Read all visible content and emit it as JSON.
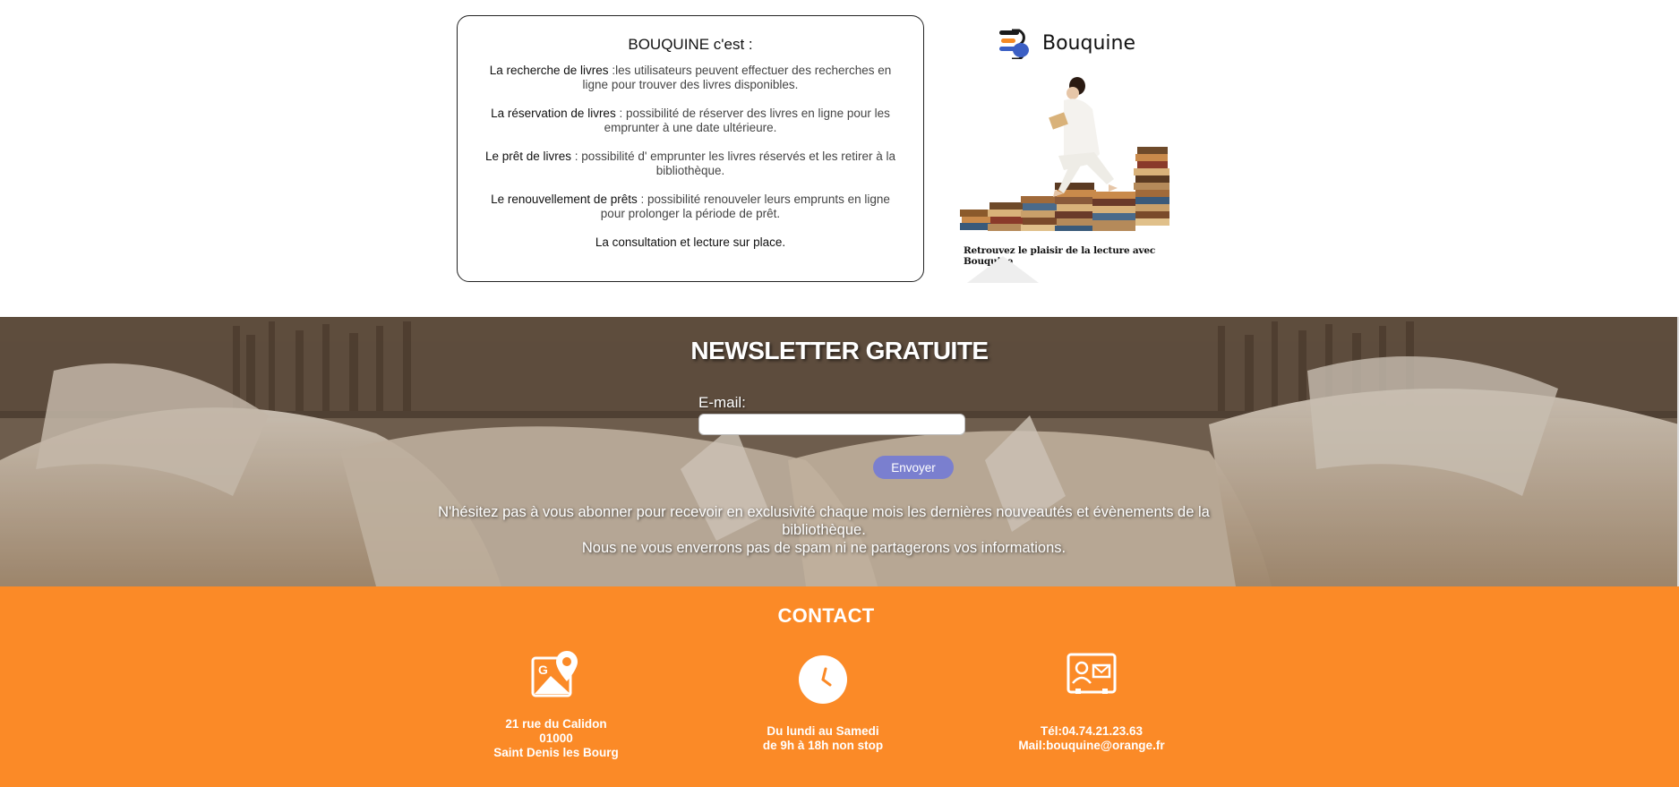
{
  "features": {
    "title": "BOUQUINE c'est :",
    "items": [
      {
        "heading": "La recherche de livres",
        "text": " :les utilisateurs peuvent effectuer des recherches en ligne pour trouver des livres disponibles."
      },
      {
        "heading": "La réservation de livres",
        "text": " : possibilité de réserver des livres en ligne pour les emprunter à une date ultérieure."
      },
      {
        "heading": "Le prêt de livres",
        "text": " : possibilité d' emprunter les livres réservés et les retirer à la bibliothèque."
      },
      {
        "heading": "Le renouvellement de prêts",
        "text": " : possibilité renouveler leurs emprunts en ligne pour prolonger la période de prêt."
      }
    ],
    "last": "La consultation et lecture sur place."
  },
  "brand": {
    "name": "Bouquine",
    "tagline": "Retrouvez le plaisir de la lecture avec Bouquine",
    "logo_colors": [
      "#1a1a1a",
      "#f58a24",
      "#3b5fc4"
    ]
  },
  "newsletter": {
    "title": "NEWSLETTER GRATUITE",
    "email_label": "E-mail:",
    "email_value": "",
    "email_placeholder": "",
    "send_label": "Envoyer",
    "text_line1": "N'hésitez pas à vous abonner pour recevoir en exclusivité chaque mois les dernières nouveautés et évènements de la bibliothèque.",
    "text_line2": "Nous ne vous enverrons pas de spam ni ne partagerons vos informations.",
    "button_color": "#7a7fcf"
  },
  "contact": {
    "title": "CONTACT",
    "background": "#fb8a27",
    "address": {
      "icon": "map-pin-icon",
      "line1": "21 rue du Calidon",
      "line2": "01000",
      "line3": "Saint Denis les Bourg"
    },
    "hours": {
      "icon": "clock-icon",
      "line1": "Du lundi au Samedi",
      "line2": "de 9h à 18h non stop"
    },
    "info": {
      "icon": "contact-card-icon",
      "line1": "Tél:04.74.21.23.63",
      "line2": "Mail:bouquine@orange.fr"
    }
  }
}
